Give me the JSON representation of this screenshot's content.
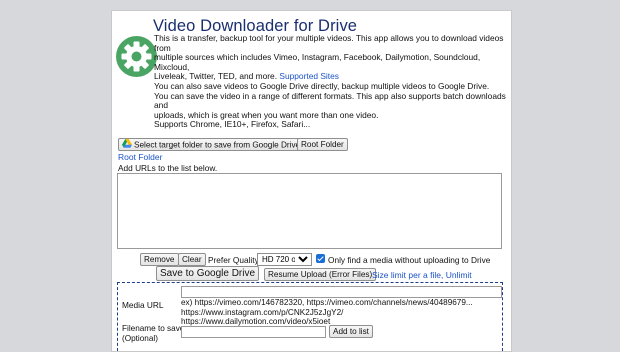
{
  "app": {
    "title": "Video Downloader for Drive",
    "description": [
      "This is a transfer, backup tool for your multiple videos. This app allows you to download videos from",
      "multiple sources which includes Vimeo, Instagram, Facebook, Dailymotion, Soundcloud, Mixcloud,",
      "Liveleak, Twitter, TED, and more.",
      "You can also save videos to Google Drive directly, backup multiple videos to Google Drive.",
      "You can save the video in a range of different formats. This app also supports batch downloads and",
      "uploads, which is great when you want more than one video.",
      "Supports Chrome, IE10+, Firefox, Safari..."
    ],
    "supported_sites_link": "Supported Sites"
  },
  "folder": {
    "select_button": "Select target folder to save from Google Drive",
    "root_button": "Root Folder",
    "current_folder": "Root Folder"
  },
  "urls": {
    "label": "Add URLs to the list below.",
    "value": ""
  },
  "controls": {
    "remove_button": "Remove",
    "clear_button": "Clear",
    "prefer_quality_label": "Prefer Quality",
    "quality_selected": "HD 720 or B",
    "only_find_label": "Only find a media without uploading to Drive",
    "only_find_checked": true,
    "save_button": "Save to Google Drive",
    "resume_button": "Resume Upload (Error Files)",
    "size_limit_link": "Size limit per a file, Unlimit"
  },
  "form": {
    "media_url_label": "Media URL",
    "media_url_value": "",
    "examples": [
      "ex) https://vimeo.com/146782320, https://vimeo.com/channels/news/40489679...",
      "https://www.instagram.com/p/CNK2J5zJgY2/",
      "https://www.dailymotion.com/video/x5ioet"
    ],
    "filename_label": "Filename to save",
    "filename_optional": "(Optional)",
    "filename_value": "",
    "add_button": "Add to list"
  },
  "colors": {
    "title": "#1a2f6e",
    "link": "#1a53c7",
    "logo_bg": "#4aa564",
    "dash_border": "#1e3e87",
    "page_bg": "#d7d8dc"
  }
}
